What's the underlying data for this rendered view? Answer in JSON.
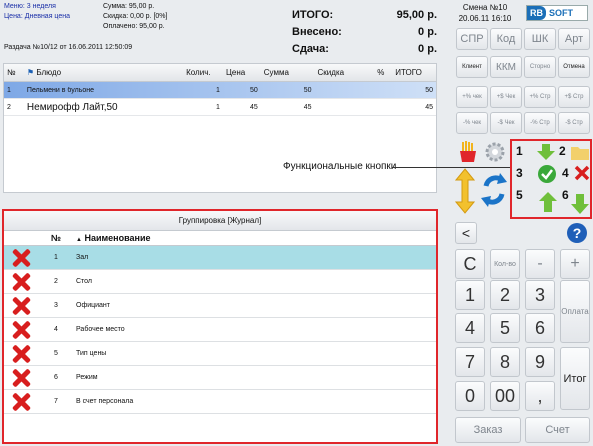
{
  "header": {
    "menu": "Меню: 3 неделя",
    "price": "Цена: Дневная цена",
    "sum": "Сумма: 95,00 р.",
    "discount": "Скидка: 0,00 р. [0%]",
    "paid": "Оплачено: 95,00 р.",
    "order_info": "Раздача №10/12 от 16.06.2011 12:50:09",
    "shift": "Смена №10",
    "datetime": "20.06.11 16:10",
    "logo_a": "RB",
    "logo_b": "SOFT"
  },
  "totals": {
    "total_label": "ИТОГО:",
    "total_value": "95,00 р.",
    "deposited_label": "Внесено:",
    "deposited_value": "0 р.",
    "change_label": "Сдача:",
    "change_value": "0 р."
  },
  "order": {
    "columns": [
      "№",
      "Блюдо",
      "Колич.",
      "Цена",
      "Сумма",
      "Скидка",
      "%",
      "ИТОГО"
    ],
    "rows": [
      {
        "no": "1",
        "name": "Пельмени в бульоне",
        "qty": "1",
        "price": "50",
        "sum": "50",
        "disc": "",
        "pct": "",
        "total": "50"
      },
      {
        "no": "2",
        "name": "Немирофф Лайт,50",
        "qty": "1",
        "price": "45",
        "sum": "45",
        "disc": "",
        "pct": "",
        "total": "45"
      }
    ]
  },
  "buttons": {
    "spr": "СПР",
    "kod": "Код",
    "shk": "ШК",
    "art": "Арт",
    "client": "Клиент",
    "kkm": "ККМ",
    "storno": "Сторно",
    "cancel": "Отмена",
    "pct_check_plus": "+% чек",
    "s_check_plus": "+$ Чек",
    "pct_str_plus": "+% Стр",
    "s_str_plus": "+$ Стр",
    "pct_check_minus": "-% чек",
    "s_check_minus": "-$ Чек",
    "pct_str_minus": "-% Стр",
    "s_str_minus": "-$ Стр"
  },
  "callout": "Функциональные кнопки",
  "fn_numbers": [
    "1",
    "2",
    "3",
    "4",
    "5",
    "6"
  ],
  "journal": {
    "title": "Группировка [Журнал]",
    "col_no": "№",
    "col_name": "Наименование",
    "rows": [
      {
        "no": "1",
        "name": "Зал"
      },
      {
        "no": "2",
        "name": "Стол"
      },
      {
        "no": "3",
        "name": "Официант"
      },
      {
        "no": "4",
        "name": "Рабочее место"
      },
      {
        "no": "5",
        "name": "Тип цены"
      },
      {
        "no": "6",
        "name": "Режим"
      },
      {
        "no": "7",
        "name": "В счет персонала"
      }
    ]
  },
  "keypad": {
    "back": "<",
    "help": "?",
    "clear": "С",
    "qty": "Кол-во",
    "minus": "-",
    "plus": "+",
    "d1": "1",
    "d2": "2",
    "d3": "3",
    "d4": "4",
    "d5": "5",
    "d6": "6",
    "d7": "7",
    "d8": "8",
    "d9": "9",
    "d0": "0",
    "d00": "00",
    "comma": ",",
    "payment": "Оплата",
    "total": "Итог",
    "order": "Заказ",
    "bill": "Счет"
  }
}
